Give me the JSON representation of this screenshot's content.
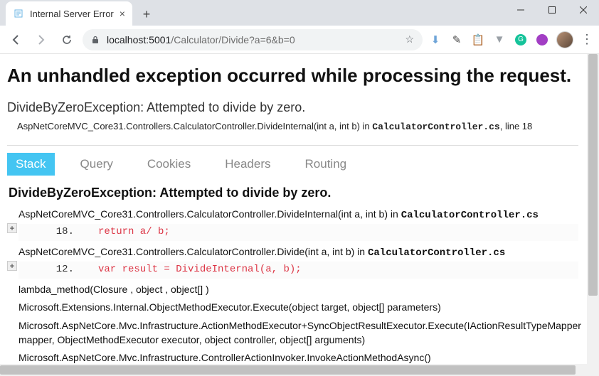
{
  "browser": {
    "tab_title": "Internal Server Error",
    "url_host": "localhost",
    "url_port": "5001",
    "url_path": "/Calculator/Divide?a=6&b=0"
  },
  "page": {
    "h1": "An unhandled exception occurred while processing the request.",
    "exception_name": "DivideByZeroException",
    "exception_msg": "Attempted to divide by zero.",
    "source_line": "AspNetCoreMVC_Core31.Controllers.CalculatorController.DivideInternal(int a, int b) in ",
    "source_file": "CalculatorController.cs",
    "source_suffix": ", line 18",
    "tabs": {
      "stack": "Stack",
      "query": "Query",
      "cookies": "Cookies",
      "headers": "Headers",
      "routing": "Routing"
    },
    "section_title": "DivideByZeroException: Attempted to divide by zero.",
    "frames": [
      {
        "expandable": true,
        "sig_pre": "AspNetCoreMVC_Core31.Controllers.CalculatorController.DivideInternal(int a, int b) in ",
        "file": "CalculatorController.cs",
        "line_no": "18.",
        "code": "return a/ b;"
      },
      {
        "expandable": true,
        "sig_pre": "AspNetCoreMVC_Core31.Controllers.CalculatorController.Divide(int a, int b) in ",
        "file": "CalculatorController.cs",
        "line_no": "12.",
        "code": "var result = DivideInternal(a, b);"
      },
      {
        "expandable": false,
        "sig_pre": "lambda_method(Closure , object , object[] )",
        "file": "",
        "line_no": "",
        "code": ""
      },
      {
        "expandable": false,
        "sig_pre": "Microsoft.Extensions.Internal.ObjectMethodExecutor.Execute(object target, object[] parameters)",
        "file": "",
        "line_no": "",
        "code": ""
      },
      {
        "expandable": false,
        "sig_pre": "Microsoft.AspNetCore.Mvc.Infrastructure.ActionMethodExecutor+SyncObjectResultExecutor.Execute(IActionResultTypeMapper mapper, ObjectMethodExecutor executor, object controller, object[] arguments)",
        "file": "",
        "line_no": "",
        "code": ""
      },
      {
        "expandable": false,
        "sig_pre": "Microsoft.AspNetCore.Mvc.Infrastructure.ControllerActionInvoker.InvokeActionMethodAsync()",
        "file": "",
        "line_no": "",
        "code": ""
      }
    ]
  }
}
